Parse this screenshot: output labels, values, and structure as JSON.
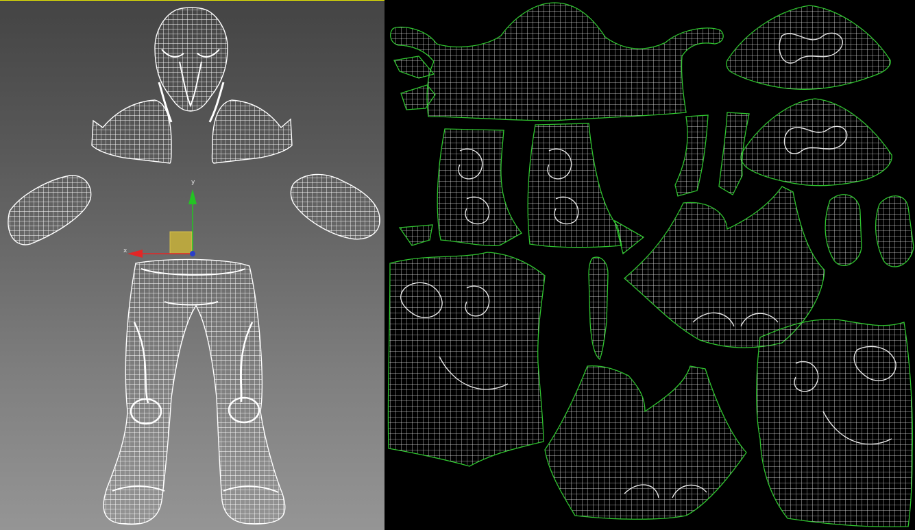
{
  "viewport": {
    "gizmo_axes": {
      "x": "x",
      "y": "y"
    },
    "colors": {
      "wire": "#ffffff",
      "axis_x": "#e32626",
      "axis_y": "#23c423",
      "axis_z": "#2a3fc9",
      "plane_handle": "#c8b13a",
      "active_border": "#e6e600"
    }
  },
  "uv_editor": {
    "colors": {
      "background": "#000000",
      "seam": "#2fc52f",
      "wire": "#e8e8e8"
    }
  }
}
